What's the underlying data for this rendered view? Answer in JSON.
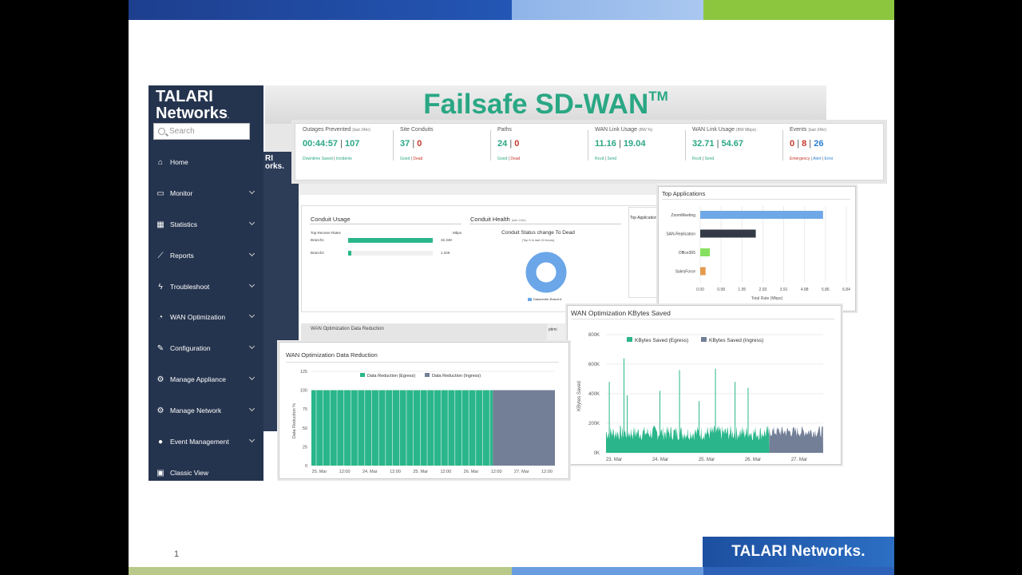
{
  "slide": {
    "number": "1",
    "footer_brand": "TALARI Networks.",
    "colors": {
      "navy": "#25344e",
      "green": "#2aa784",
      "red": "#c8382e",
      "blue": "#2a7fd0",
      "slate": "#737f97"
    }
  },
  "logo": {
    "line1": "TALARI",
    "line2": "Networks",
    "mark": "."
  },
  "search": {
    "placeholder": "Search",
    "icon": "search-icon"
  },
  "sidebar": {
    "items": [
      {
        "label": "Home",
        "icon": "home-icon"
      },
      {
        "label": "Monitor",
        "icon": "monitor-icon"
      },
      {
        "label": "Statistics",
        "icon": "table-icon"
      },
      {
        "label": "Reports",
        "icon": "line-chart-icon"
      },
      {
        "label": "Troubleshoot",
        "icon": "bolt-icon"
      },
      {
        "label": "WAN Optimization",
        "icon": "speedometer-icon"
      },
      {
        "label": "Configuration",
        "icon": "wrench-icon"
      },
      {
        "label": "Manage Appliance",
        "icon": "gear-icon"
      },
      {
        "label": "Manage Network",
        "icon": "gears-icon"
      },
      {
        "label": "Event Management",
        "icon": "alert-icon"
      },
      {
        "label": "Classic View",
        "icon": "classic-view-icon"
      }
    ]
  },
  "banner": {
    "title": "Failsafe SD-WAN",
    "tm": "TM"
  },
  "stats": [
    {
      "label": "Outages Prevented",
      "note": "(last 24hr)",
      "v1": "00:44:57",
      "v2": "107",
      "s1": "Downtime Saved",
      "s2": "Incidents"
    },
    {
      "label": "Site Conduits",
      "note": "",
      "v1": "37",
      "v2": "0",
      "s1": "Good",
      "s2": "Dead"
    },
    {
      "label": "Paths",
      "note": "",
      "v1": "24",
      "v2": "0",
      "s1": "Good",
      "s2": "Dead"
    },
    {
      "label": "WAN Link Usage",
      "note": "(BW %)",
      "v1": "11.16",
      "v2": "19.04",
      "s1": "Rcvd",
      "s2": "Send"
    },
    {
      "label": "WAN Link Usage",
      "note": "(BW Mbps)",
      "v1": "32.71",
      "v2": "54.67",
      "s1": "Rcvd",
      "s2": "Send"
    },
    {
      "label": "Events",
      "note": "(last 24hr)",
      "v1": "0",
      "v2": "8",
      "v3": "26",
      "s1": "Emergency",
      "s2": "Alert",
      "s3": "Error"
    }
  ],
  "conduit_panel": {
    "title": "Conduit Usage",
    "header": "Top Receive Rates",
    "unit": "Mbps",
    "rows": [
      {
        "name": "Branch1",
        "value": "32.348",
        "fill": 1.0
      },
      {
        "name": "Branch2",
        "value": "1.346",
        "fill": 0.04
      }
    ]
  },
  "health_panel": {
    "title": "Conduit Health",
    "note": "(last 24hr)",
    "chart_title": "Conduit Status change To Dead",
    "chart_sub": "(Top 5 in last 24 hours)",
    "legend": "Datacenter-Branch1"
  },
  "ghost": {
    "wan_red": "WAN Optimization Data Reduction",
    "top_apps": "Top Applications",
    "kb": "WAN Optimization KBytes Saved"
  },
  "top_apps": {
    "title": "Top Applications",
    "xlabel": "Total Rate (Mbps)",
    "chart_data": {
      "type": "bar",
      "categories": [
        "ZoomMeeting",
        "SAN-Replication",
        "Office365",
        "SalesForce"
      ],
      "values": [
        5.75,
        2.6,
        0.45,
        0.25
      ],
      "colors": [
        "#6fa8e6",
        "#333a45",
        "#86e05f",
        "#e39a4c"
      ],
      "xticks": [
        "0.00",
        "0.98",
        "1.95",
        "2.93",
        "3.91",
        "4.88",
        "5.86",
        "6.84"
      ],
      "xlim": [
        0,
        6.84
      ]
    }
  },
  "wan_reduction": {
    "title": "WAN Optimization Data Reduction",
    "ylabel": "Data Reduction %",
    "legend": [
      "Data Reduction (Egress)",
      "Data Reduction (Ingress)"
    ],
    "chart_data": {
      "type": "area",
      "ylim": [
        0,
        125
      ],
      "yticks": [
        "125",
        "100",
        "75",
        "50",
        "25",
        "0"
      ],
      "xticks": [
        "25. Mar",
        "12:00",
        "24. Mar",
        "12:00",
        "25. Mar",
        "12:00",
        "26. Mar",
        "12:00",
        "27. Mar",
        "12:00"
      ],
      "series": [
        {
          "name": "Data Reduction (Egress)",
          "level": 100,
          "color": "#2ab68a"
        },
        {
          "name": "Data Reduction (Ingress)",
          "level": 100,
          "color": "#737f97"
        }
      ],
      "ingress_start_fraction": 0.745
    }
  },
  "kb_saved": {
    "title": "WAN Optimization KBytes Saved",
    "ylabel": "KBytes Saved",
    "legend": [
      "KBytes Saved (Egress)",
      "KBytes Saved (Ingress)"
    ],
    "chart_data": {
      "type": "area",
      "ylim": [
        0,
        800000
      ],
      "yticks": [
        "800K",
        "600K",
        "400K",
        "200K",
        "0K"
      ],
      "xticks": [
        "23. Mar",
        "24. Mar",
        "25. Mar",
        "26. Mar",
        "27. Mar"
      ],
      "typical_egress": 150000,
      "spikes": [
        {
          "t": 0.02,
          "v": 480000
        },
        {
          "t": 0.11,
          "v": 640000
        },
        {
          "t": 0.13,
          "v": 390000
        },
        {
          "t": 0.33,
          "v": 420000
        },
        {
          "t": 0.45,
          "v": 560000
        },
        {
          "t": 0.57,
          "v": 350000
        },
        {
          "t": 0.67,
          "v": 570000
        },
        {
          "t": 0.79,
          "v": 480000
        },
        {
          "t": 0.87,
          "v": 440000
        }
      ],
      "ingress_start_fraction": 0.752,
      "typical_ingress": 160000
    }
  }
}
